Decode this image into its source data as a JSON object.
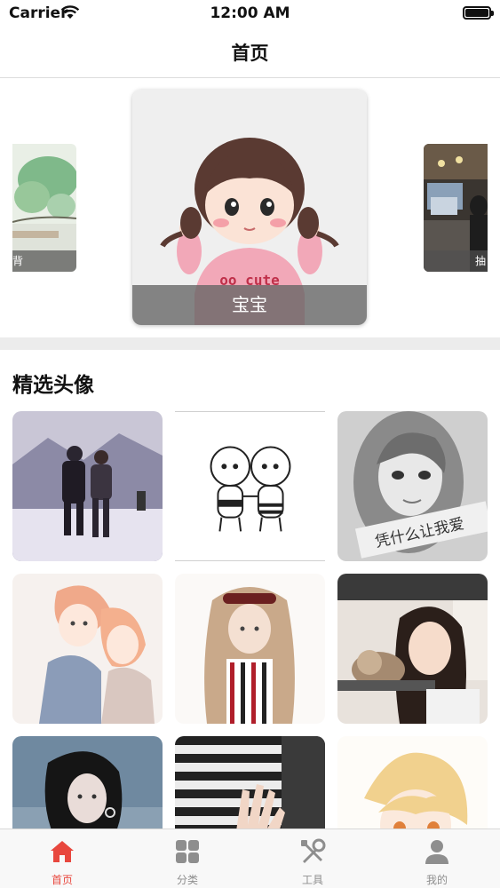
{
  "status_bar": {
    "carrier": "Carrier",
    "time": "12:00 AM"
  },
  "nav": {
    "title": "首页"
  },
  "carousel": {
    "left_caption": "背",
    "center_caption": "宝宝",
    "right_caption": "抽"
  },
  "section": {
    "title": "精选头像"
  },
  "tiles": [
    {
      "name": "couple-snow-avatar"
    },
    {
      "name": "cartoon-babies-avatar"
    },
    {
      "name": "girl-bw-avatar",
      "text": "凭什么让我爱"
    },
    {
      "name": "anime-couple-avatar"
    },
    {
      "name": "anime-girl-avatar"
    },
    {
      "name": "girl-cat-avatar"
    },
    {
      "name": "dark-hair-girl-avatar"
    },
    {
      "name": "hand-stripes-avatar"
    },
    {
      "name": "anime-blonde-avatar"
    }
  ],
  "tab_bar": {
    "items": [
      {
        "label": "首页",
        "icon": "home-icon",
        "active": true
      },
      {
        "label": "分类",
        "icon": "grid-icon",
        "active": false
      },
      {
        "label": "工具",
        "icon": "tools-icon",
        "active": false
      },
      {
        "label": "我的",
        "icon": "person-icon",
        "active": false
      }
    ],
    "active_color": "#e8473e",
    "inactive_color": "#8e8e8e"
  }
}
